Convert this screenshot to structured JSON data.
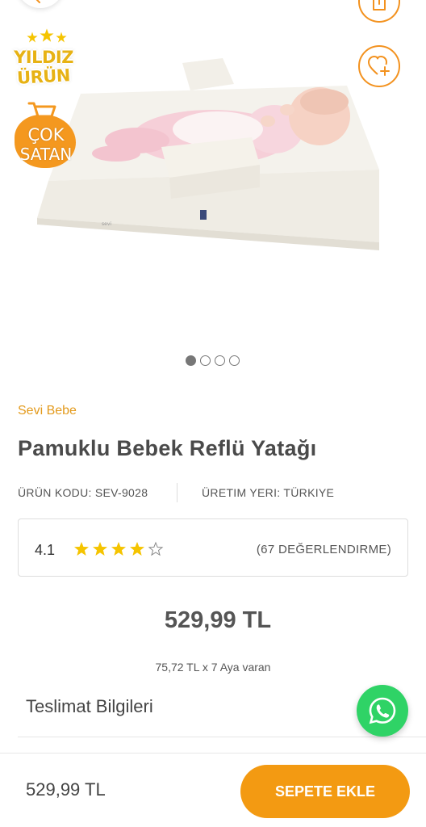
{
  "badges": {
    "star_line1": "YILDIZ",
    "star_line2": "ÜRÜN",
    "sale_line1": "ÇOK",
    "sale_line2": "SATAN"
  },
  "gallery": {
    "total_images": 4,
    "active_index": 0
  },
  "product": {
    "brand": "Sevi Bebe",
    "title": "Pamuklu Bebek Reflü Yatağı",
    "code": "ÜRÜN KODU: SEV-9028",
    "origin": "ÜRETIM YERI: TÜRKIYE",
    "mattress_tag": "sevi"
  },
  "rating": {
    "value": "4.1",
    "stars_filled": 4,
    "stars_total": 5,
    "count_text": "(67 DEĞERLENDIRME)"
  },
  "pricing": {
    "price": "529,99 TL",
    "installment": "75,72 TL x 7 Aya varan"
  },
  "delivery": {
    "label": "Teslimat Bilgileri"
  },
  "bottom_bar": {
    "price": "529,99 TL",
    "add_to_cart": "SEPETE EKLE"
  },
  "colors": {
    "accent": "#f39a12",
    "brand": "#e39a1c",
    "star": "#f5c400",
    "whatsapp": "#2fd366"
  },
  "icons": [
    "back-arrow-icon",
    "share-icon",
    "favorite-add-icon",
    "star-icon",
    "cart-icon",
    "whatsapp-icon"
  ]
}
